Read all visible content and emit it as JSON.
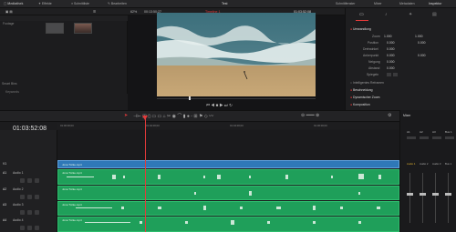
{
  "top_bar": {
    "items": [
      "Mediathek",
      "Effekte",
      "Schnittliste",
      "Bearbeiten",
      "Test",
      "Schnittfenster",
      "Mixer",
      "Metadaten",
      "Inspektor"
    ],
    "title": "Test"
  },
  "viewer_bar": {
    "zoom": "62%",
    "source_timecode": "00:13:50:27",
    "record_timecode": "01:03:52;08",
    "clip_name": "Jona Türke.mp4",
    "timeline_label": "Timeline 1"
  },
  "media_pool": {
    "folder_label": "Footage",
    "section_label": "Smart Bins",
    "section_sub": "Keywords"
  },
  "inspector": {
    "section_transform": "Umwandlung",
    "rows": [
      {
        "label": "Zoom",
        "x": "1.000",
        "y": "1.000"
      },
      {
        "label": "Position",
        "x": "0.000",
        "y": "0.000"
      },
      {
        "label": "Drehwinkel",
        "x": "0.000"
      },
      {
        "label": "Ankerpunkt",
        "x": "0.000",
        "y": "0.000"
      },
      {
        "label": "Neigung",
        "x": "0.000"
      },
      {
        "label": "Abstand",
        "x": "0.000"
      },
      {
        "label": "Spiegeln",
        "x": ""
      }
    ],
    "smart_reframe": "Intelligentes Reframen",
    "section_crop": "Beschneidung",
    "section_zoom": "Dynamischer Zoom",
    "section_composite": "Komposition"
  },
  "timeline": {
    "timecode": "01:03:52;08",
    "ruler_labels": [
      "01:00:00;00",
      "01:02:00;00",
      "01:04:00;00",
      "01:06:00;00"
    ],
    "tracks": [
      {
        "id": "V1",
        "name": "",
        "clip": "Jona Türke.mp4",
        "kind": "video"
      },
      {
        "id": "A1",
        "name": "Audio 1",
        "clip": "Jona Türke.mp4",
        "kind": "audio"
      },
      {
        "id": "A2",
        "name": "Audio 2",
        "clip": "Jona Türke.mp4",
        "kind": "audio"
      },
      {
        "id": "A3",
        "name": "Audio 3",
        "clip": "Jona Türke.mp4",
        "kind": "audio"
      },
      {
        "id": "A4",
        "name": "Audio 4",
        "clip": "Jona Türke.mp4",
        "kind": "audio"
      }
    ]
  },
  "mixer": {
    "title": "Mixer",
    "channels": [
      "A1",
      "A2",
      "A3",
      "Bus 1"
    ],
    "channel_labels": [
      "Audio 1",
      "Audio 2",
      "Audio 3",
      "Bus 1"
    ]
  },
  "colors": {
    "accent_red": "#e43a3a",
    "video_clip": "#2f78b8",
    "audio_clip": "#1f9f5a"
  }
}
